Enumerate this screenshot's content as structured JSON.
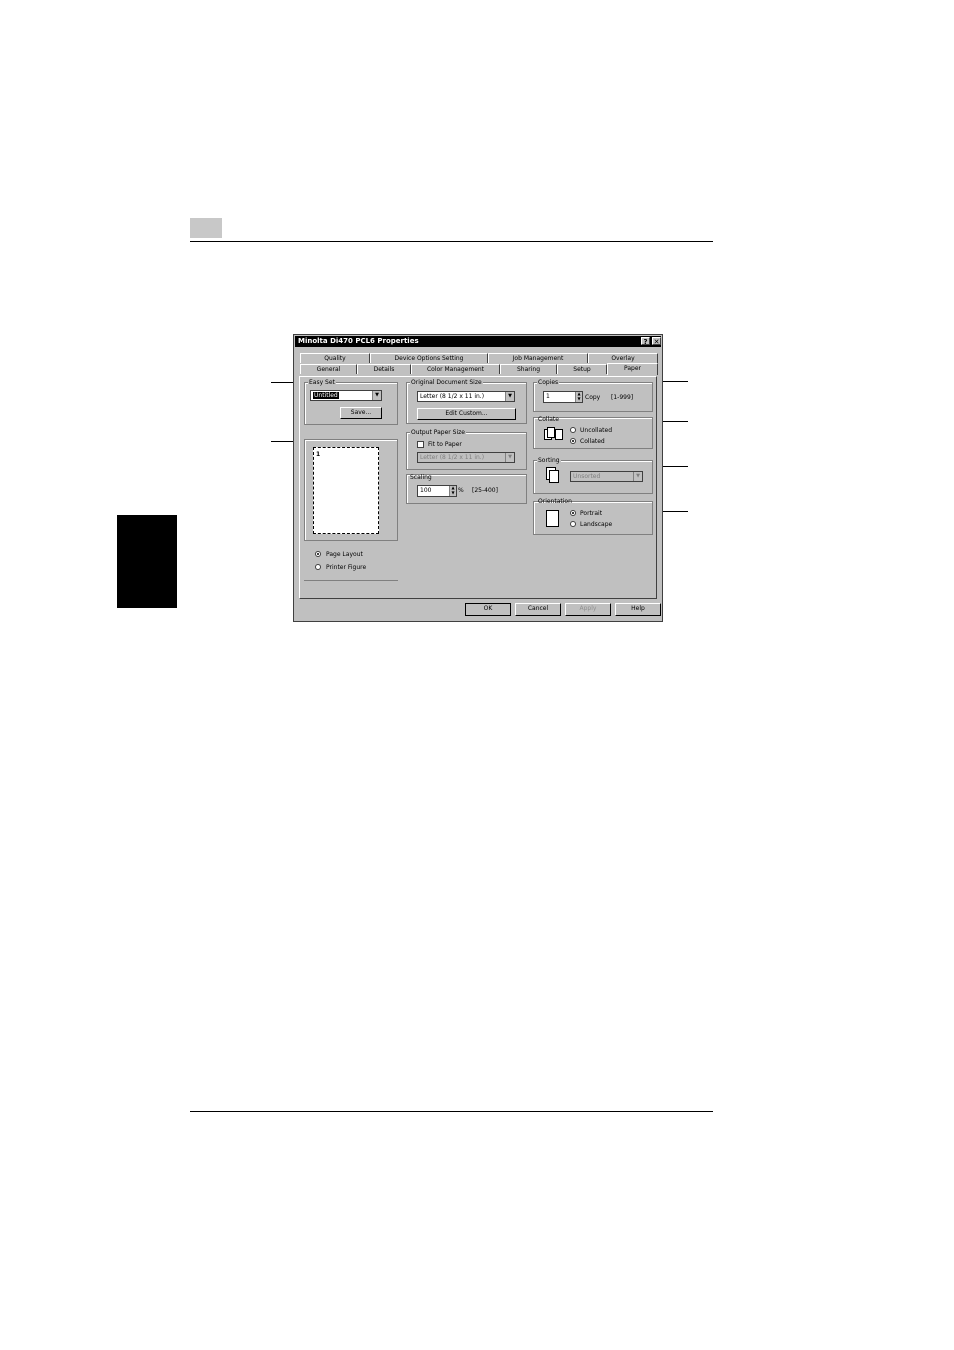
{
  "dialog": {
    "title": "Minolta Di470 PCL6 Properties",
    "help_btn": "?",
    "close_btn": "✕",
    "tabs_row1": [
      "Quality",
      "Device Options Setting",
      "Job Management",
      "Overlay"
    ],
    "tabs_row2": [
      "General",
      "Details",
      "Color Management",
      "Sharing",
      "Setup",
      "Paper"
    ],
    "active_tab": "Paper"
  },
  "paper": {
    "easy_set": {
      "label": "Easy Set",
      "value": "Untitled",
      "save_label": "Save..."
    },
    "preview": {
      "page_number": "1"
    },
    "view_options": {
      "page_layout": "Page Layout",
      "printer_figure": "Printer Figure",
      "selected": "page_layout"
    },
    "original_document_size": {
      "label": "Original Document Size",
      "value": "Letter (8 1/2 x 11 in.)",
      "edit_custom": "Edit Custom..."
    },
    "output_paper_size": {
      "label": "Output Paper Size",
      "fit_to_paper": "Fit to Paper",
      "value": "Letter (8 1/2 x 11 in.)"
    },
    "scaling": {
      "label": "Scaling",
      "value": "100",
      "unit": "%",
      "range": "[25-400]"
    },
    "copies": {
      "label": "Copies",
      "value": "1",
      "unit": "Copy",
      "range": "[1-999]"
    },
    "collate": {
      "label": "Collate",
      "uncollated": "Uncollated",
      "collated": "Collated",
      "selected": "collated"
    },
    "sorting": {
      "label": "Sorting",
      "value": "Unsorted"
    },
    "orientation": {
      "label": "Orientation",
      "portrait": "Portrait",
      "landscape": "Landscape",
      "selected": "portrait"
    }
  },
  "footer": {
    "ok": "OK",
    "cancel": "Cancel",
    "apply": "Apply",
    "help": "Help"
  }
}
